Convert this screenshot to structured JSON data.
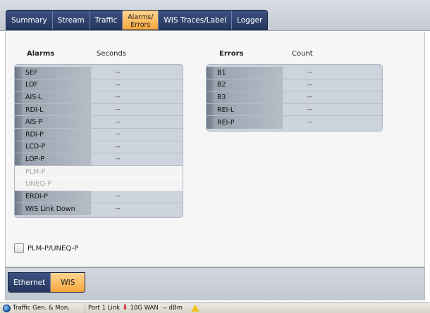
{
  "tabs": [
    {
      "label": "Summary",
      "active": false
    },
    {
      "label": "Stream",
      "active": false
    },
    {
      "label": "Traffic",
      "active": false
    },
    {
      "label_line1": "Alarms/",
      "label_line2": "Errors",
      "active": true
    },
    {
      "label": "WIS Traces/Label",
      "active": false
    },
    {
      "label": "Logger",
      "active": false
    }
  ],
  "alarms": {
    "header": "Alarms",
    "value_header": "Seconds",
    "rows": [
      {
        "name": "SEF",
        "value": "--"
      },
      {
        "name": "LOF",
        "value": "--"
      },
      {
        "name": "AIS-L",
        "value": "--"
      },
      {
        "name": "RDI-L",
        "value": "--"
      },
      {
        "name": "AIS-P",
        "value": "--"
      },
      {
        "name": "RDI-P",
        "value": "--"
      },
      {
        "name": "LCD-P",
        "value": "--"
      },
      {
        "name": "LOP-P",
        "value": "--"
      },
      {
        "name": "PLM-P",
        "value": ""
      },
      {
        "name": "UNEQ-P",
        "value": ""
      },
      {
        "name": "ERDI-P",
        "value": "--"
      },
      {
        "name": "WIS Link Down",
        "value": "--"
      }
    ]
  },
  "errors": {
    "header": "Errors",
    "value_header": "Count",
    "rows": [
      {
        "name": "B1",
        "value": "--"
      },
      {
        "name": "B2",
        "value": "--"
      },
      {
        "name": "B3",
        "value": "--"
      },
      {
        "name": "REI-L",
        "value": "--"
      },
      {
        "name": "REI-P",
        "value": "--"
      }
    ]
  },
  "checkbox": {
    "label": "PLM-P/UNEQ-P",
    "checked": false
  },
  "subtabs": [
    {
      "label": "Ethernet",
      "active": false
    },
    {
      "label": "WIS",
      "active": true
    }
  ],
  "status": {
    "app": "Traffic Gen. & Mon.",
    "port": "Port 1 Link",
    "rate": "10G WAN",
    "power": "-- dBm"
  },
  "colors": {
    "tab_active": "#f5a63b",
    "tab_inactive": "#2d3f66",
    "link_down_arrow": "#d02020",
    "warning": "#f2c21b"
  }
}
